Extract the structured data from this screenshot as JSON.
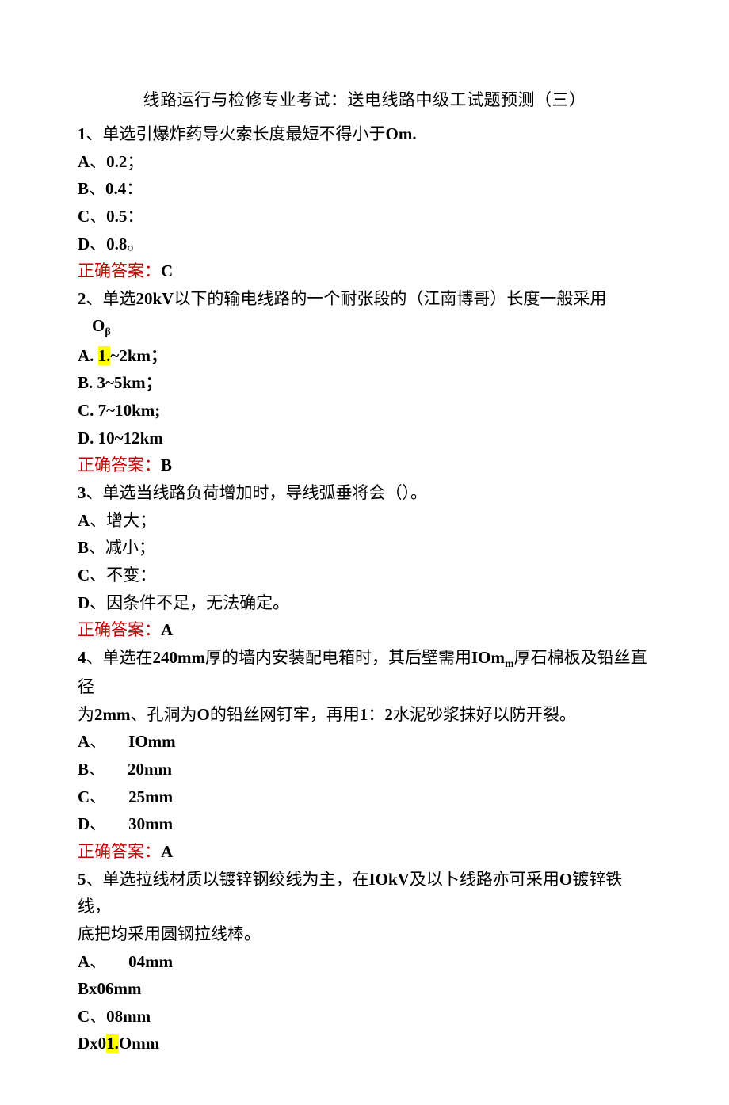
{
  "title": "线路运行与检修专业考试：送电线路中级工试题预测（三）",
  "q1": {
    "stem_a": "1",
    "stem_b": "、单选引爆炸药导火索长度最短不得小于",
    "stem_c": "Om.",
    "opt_a_pre": "A",
    "opt_a_sep": "、",
    "opt_a_val": "0.2",
    "opt_a_end": "；",
    "opt_b_pre": "B",
    "opt_b_sep": "、",
    "opt_b_val": "0.4",
    "opt_b_end": "：",
    "opt_c_pre": "C",
    "opt_c_sep": "、",
    "opt_c_val": "0.5",
    "opt_c_end": "：",
    "opt_d_pre": "D",
    "opt_d_sep": "、",
    "opt_d_val": "0.8",
    "opt_d_end": "。",
    "ans_label": "正确答案：",
    "ans_val": "C"
  },
  "q2": {
    "stem_a": "2",
    "stem_b": "、单选",
    "stem_c": "20kV",
    "stem_d": "以下的输电线路的一个耐张段的（江南博哥）长度一般采用",
    "stem_e": "O",
    "stem_f": "β",
    "opt_a_pre": "A.  ",
    "opt_a_hl": "1.",
    "opt_a_rest": "~2km",
    "opt_a_end": "；",
    "opt_b_pre": "B.  ",
    "opt_b_val": "3~5km",
    "opt_b_end": "；",
    "opt_c_pre": "C.  ",
    "opt_c_val": "7~10km;",
    "opt_d_pre": "D.  ",
    "opt_d_val": "10~12km",
    "ans_label": "正确答案：",
    "ans_val": "B"
  },
  "q3": {
    "stem_a": "3",
    "stem_b": "、单选当线路负荷增加时，导线弧垂将会（）。",
    "opt_a_pre": "A",
    "opt_a_sep": "、增大；",
    "opt_b_pre": "B",
    "opt_b_sep": "、减小；",
    "opt_c_pre": "C",
    "opt_c_sep": "、不变：",
    "opt_d_pre": "D",
    "opt_d_sep": "、因条件不足，无法确定。",
    "ans_label": "正确答案：",
    "ans_val": "A"
  },
  "q4": {
    "stem_a": "4",
    "stem_b": "、单选在",
    "stem_c": "240mm",
    "stem_d": "厚的墙内安装配电箱时，其后壁需用",
    "stem_e": "IOm",
    "stem_f": "m",
    "stem_g": "厚石棉板及铅丝直径",
    "stem2_a": "为",
    "stem2_b": "2mm",
    "stem2_c": "、孔洞为",
    "stem2_d": "O",
    "stem2_e": "的铅丝网钉牢，再用",
    "stem2_f": "1",
    "stem2_g": "：",
    "stem2_h": "2",
    "stem2_i": "水泥砂浆抹好以防开裂。",
    "opt_a_pre": "A",
    "opt_a_sep": "、",
    "opt_a_val": "IOmm",
    "opt_b_pre": "B",
    "opt_b_sep": "、",
    "opt_b_val": "20mm",
    "opt_c_pre": "C",
    "opt_c_sep": "、",
    "opt_c_val": "25mm",
    "opt_d_pre": "D",
    "opt_d_sep": "、",
    "opt_d_val": "30mm",
    "ans_label": "正确答案：",
    "ans_val": "A"
  },
  "q5": {
    "stem_a": "5",
    "stem_b": "、单选拉线材质以镀锌钢绞线为主，在",
    "stem_c": "IOkV",
    "stem_d": "及以卜线路亦可采用",
    "stem_e": "O",
    "stem_f": "镀锌铁线，",
    "stem2": "底把均采用圆钢拉线棒。",
    "opt_a_pre": "A",
    "opt_a_sep": "、",
    "opt_a_val": "04mm",
    "opt_b": "Bx06mm",
    "opt_c_pre": "C",
    "opt_c_sep": "、",
    "opt_c_val": "08mm",
    "opt_d_pre": "Dx0",
    "opt_d_hl": "1.",
    "opt_d_rest": "Omm"
  }
}
